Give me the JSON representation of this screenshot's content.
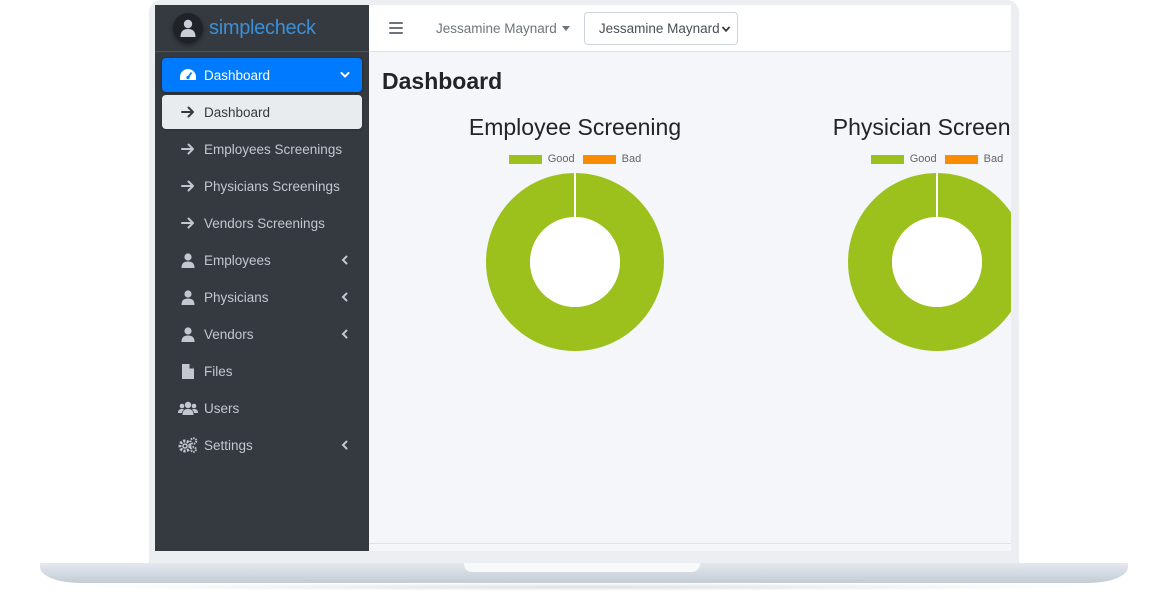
{
  "brand": {
    "name": "simplecheck"
  },
  "topbar": {
    "user_menu_label": "Jessamine Maynard",
    "user_select_value": "Jessamine Maynard"
  },
  "sidebar": {
    "items": [
      {
        "label": "Dashboard",
        "icon": "tachometer-icon",
        "state": "active",
        "caret": "down"
      },
      {
        "label": "Dashboard",
        "icon": "arrow-right-icon",
        "state": "sub-active"
      },
      {
        "label": "Employees Screenings",
        "icon": "arrow-right-icon"
      },
      {
        "label": "Physicians Screenings",
        "icon": "arrow-right-icon"
      },
      {
        "label": "Vendors Screenings",
        "icon": "arrow-right-icon"
      },
      {
        "label": "Employees",
        "icon": "user-icon",
        "caret": "left"
      },
      {
        "label": "Physicians",
        "icon": "user-icon",
        "caret": "left"
      },
      {
        "label": "Vendors",
        "icon": "user-icon",
        "caret": "left"
      },
      {
        "label": "Files",
        "icon": "file-icon"
      },
      {
        "label": "Users",
        "icon": "users-icon"
      },
      {
        "label": "Settings",
        "icon": "cogs-icon",
        "caret": "left"
      }
    ]
  },
  "main": {
    "page_title": "Dashboard"
  },
  "colors": {
    "sidebar_bg": "#343a40",
    "accent": "#007bff",
    "good": "#9cc11d",
    "bad": "#fb8c00"
  },
  "chart_data": [
    {
      "type": "pie",
      "title": "Employee Screening",
      "categories": [
        "Good",
        "Bad"
      ],
      "values": [
        1,
        0
      ],
      "legend": "top"
    },
    {
      "type": "pie",
      "title": "Physician Screening",
      "categories": [
        "Good",
        "Bad"
      ],
      "values": [
        1,
        0
      ],
      "legend": "top"
    }
  ]
}
